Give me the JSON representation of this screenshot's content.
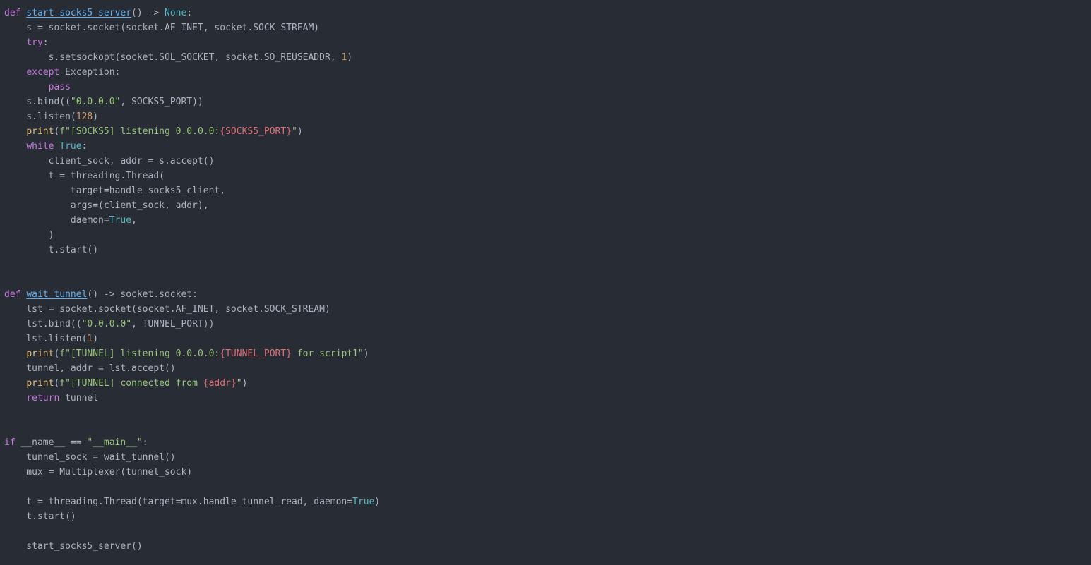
{
  "colors": {
    "background": "#282c34",
    "plain": "#abb2bf",
    "keyword": "#c678dd",
    "function": "#61afef",
    "constant": "#56b6c2",
    "string": "#98c379",
    "number": "#d19a66",
    "interpolation": "#e06c75",
    "builtin": "#e5c07b"
  },
  "code": {
    "language": "python",
    "lines": [
      [
        [
          "kw",
          "def"
        ],
        [
          "plain",
          " "
        ],
        [
          "fndef",
          "start_socks5_server"
        ],
        [
          "plain",
          "() -> "
        ],
        [
          "const",
          "None"
        ],
        [
          "plain",
          ":"
        ]
      ],
      [
        [
          "plain",
          "    s = socket.socket(socket.AF_INET, socket.SOCK_STREAM)"
        ]
      ],
      [
        [
          "plain",
          "    "
        ],
        [
          "kw",
          "try"
        ],
        [
          "plain",
          ":"
        ]
      ],
      [
        [
          "plain",
          "        s.setsockopt(socket.SOL_SOCKET, socket.SO_REUSEADDR, "
        ],
        [
          "num",
          "1"
        ],
        [
          "plain",
          ")"
        ]
      ],
      [
        [
          "plain",
          "    "
        ],
        [
          "kw",
          "except"
        ],
        [
          "plain",
          " Exception:"
        ]
      ],
      [
        [
          "plain",
          "        "
        ],
        [
          "kw",
          "pass"
        ]
      ],
      [
        [
          "plain",
          "    s.bind(("
        ],
        [
          "str",
          "\"0.0.0.0\""
        ],
        [
          "plain",
          ", SOCKS5_PORT))"
        ]
      ],
      [
        [
          "plain",
          "    s.listen("
        ],
        [
          "num",
          "128"
        ],
        [
          "plain",
          ")"
        ]
      ],
      [
        [
          "plain",
          "    "
        ],
        [
          "builtin",
          "print"
        ],
        [
          "plain",
          "("
        ],
        [
          "str",
          "f\"[SOCKS5] listening 0.0.0.0:"
        ],
        [
          "interp",
          "{SOCKS5_PORT}"
        ],
        [
          "str",
          "\""
        ],
        [
          "plain",
          ")"
        ]
      ],
      [
        [
          "plain",
          "    "
        ],
        [
          "kw",
          "while"
        ],
        [
          "plain",
          " "
        ],
        [
          "const",
          "True"
        ],
        [
          "plain",
          ":"
        ]
      ],
      [
        [
          "plain",
          "        client_sock, addr = s.accept()"
        ]
      ],
      [
        [
          "plain",
          "        t = threading.Thread("
        ]
      ],
      [
        [
          "plain",
          "            target=handle_socks5_client,"
        ]
      ],
      [
        [
          "plain",
          "            args=(client_sock, addr),"
        ]
      ],
      [
        [
          "plain",
          "            daemon="
        ],
        [
          "const",
          "True"
        ],
        [
          "plain",
          ","
        ]
      ],
      [
        [
          "plain",
          "        )"
        ]
      ],
      [
        [
          "plain",
          "        t.start()"
        ]
      ],
      [],
      [],
      [
        [
          "kw",
          "def"
        ],
        [
          "plain",
          " "
        ],
        [
          "fndef",
          "wait_tunnel"
        ],
        [
          "plain",
          "() -> socket.socket:"
        ]
      ],
      [
        [
          "plain",
          "    lst = socket.socket(socket.AF_INET, socket.SOCK_STREAM)"
        ]
      ],
      [
        [
          "plain",
          "    lst.bind(("
        ],
        [
          "str",
          "\"0.0.0.0\""
        ],
        [
          "plain",
          ", TUNNEL_PORT))"
        ]
      ],
      [
        [
          "plain",
          "    lst.listen("
        ],
        [
          "num",
          "1"
        ],
        [
          "plain",
          ")"
        ]
      ],
      [
        [
          "plain",
          "    "
        ],
        [
          "builtin",
          "print"
        ],
        [
          "plain",
          "("
        ],
        [
          "str",
          "f\"[TUNNEL] listening 0.0.0.0:"
        ],
        [
          "interp",
          "{TUNNEL_PORT}"
        ],
        [
          "str",
          " for script1\""
        ],
        [
          "plain",
          ")"
        ]
      ],
      [
        [
          "plain",
          "    tunnel, addr = lst.accept()"
        ]
      ],
      [
        [
          "plain",
          "    "
        ],
        [
          "builtin",
          "print"
        ],
        [
          "plain",
          "("
        ],
        [
          "str",
          "f\"[TUNNEL] connected from "
        ],
        [
          "interp",
          "{addr}"
        ],
        [
          "str",
          "\""
        ],
        [
          "plain",
          ")"
        ]
      ],
      [
        [
          "plain",
          "    "
        ],
        [
          "kw",
          "return"
        ],
        [
          "plain",
          " tunnel"
        ]
      ],
      [],
      [],
      [
        [
          "kw",
          "if"
        ],
        [
          "plain",
          " __name__ == "
        ],
        [
          "str",
          "\"__main__\""
        ],
        [
          "plain",
          ":"
        ]
      ],
      [
        [
          "plain",
          "    tunnel_sock = wait_tunnel()"
        ]
      ],
      [
        [
          "plain",
          "    mux = Multiplexer(tunnel_sock)"
        ]
      ],
      [],
      [
        [
          "plain",
          "    t = threading.Thread(target=mux.handle_tunnel_read, daemon="
        ],
        [
          "const",
          "True"
        ],
        [
          "plain",
          ")"
        ]
      ],
      [
        [
          "plain",
          "    t.start()"
        ]
      ],
      [],
      [
        [
          "plain",
          "    start_socks5_server()"
        ]
      ]
    ]
  }
}
